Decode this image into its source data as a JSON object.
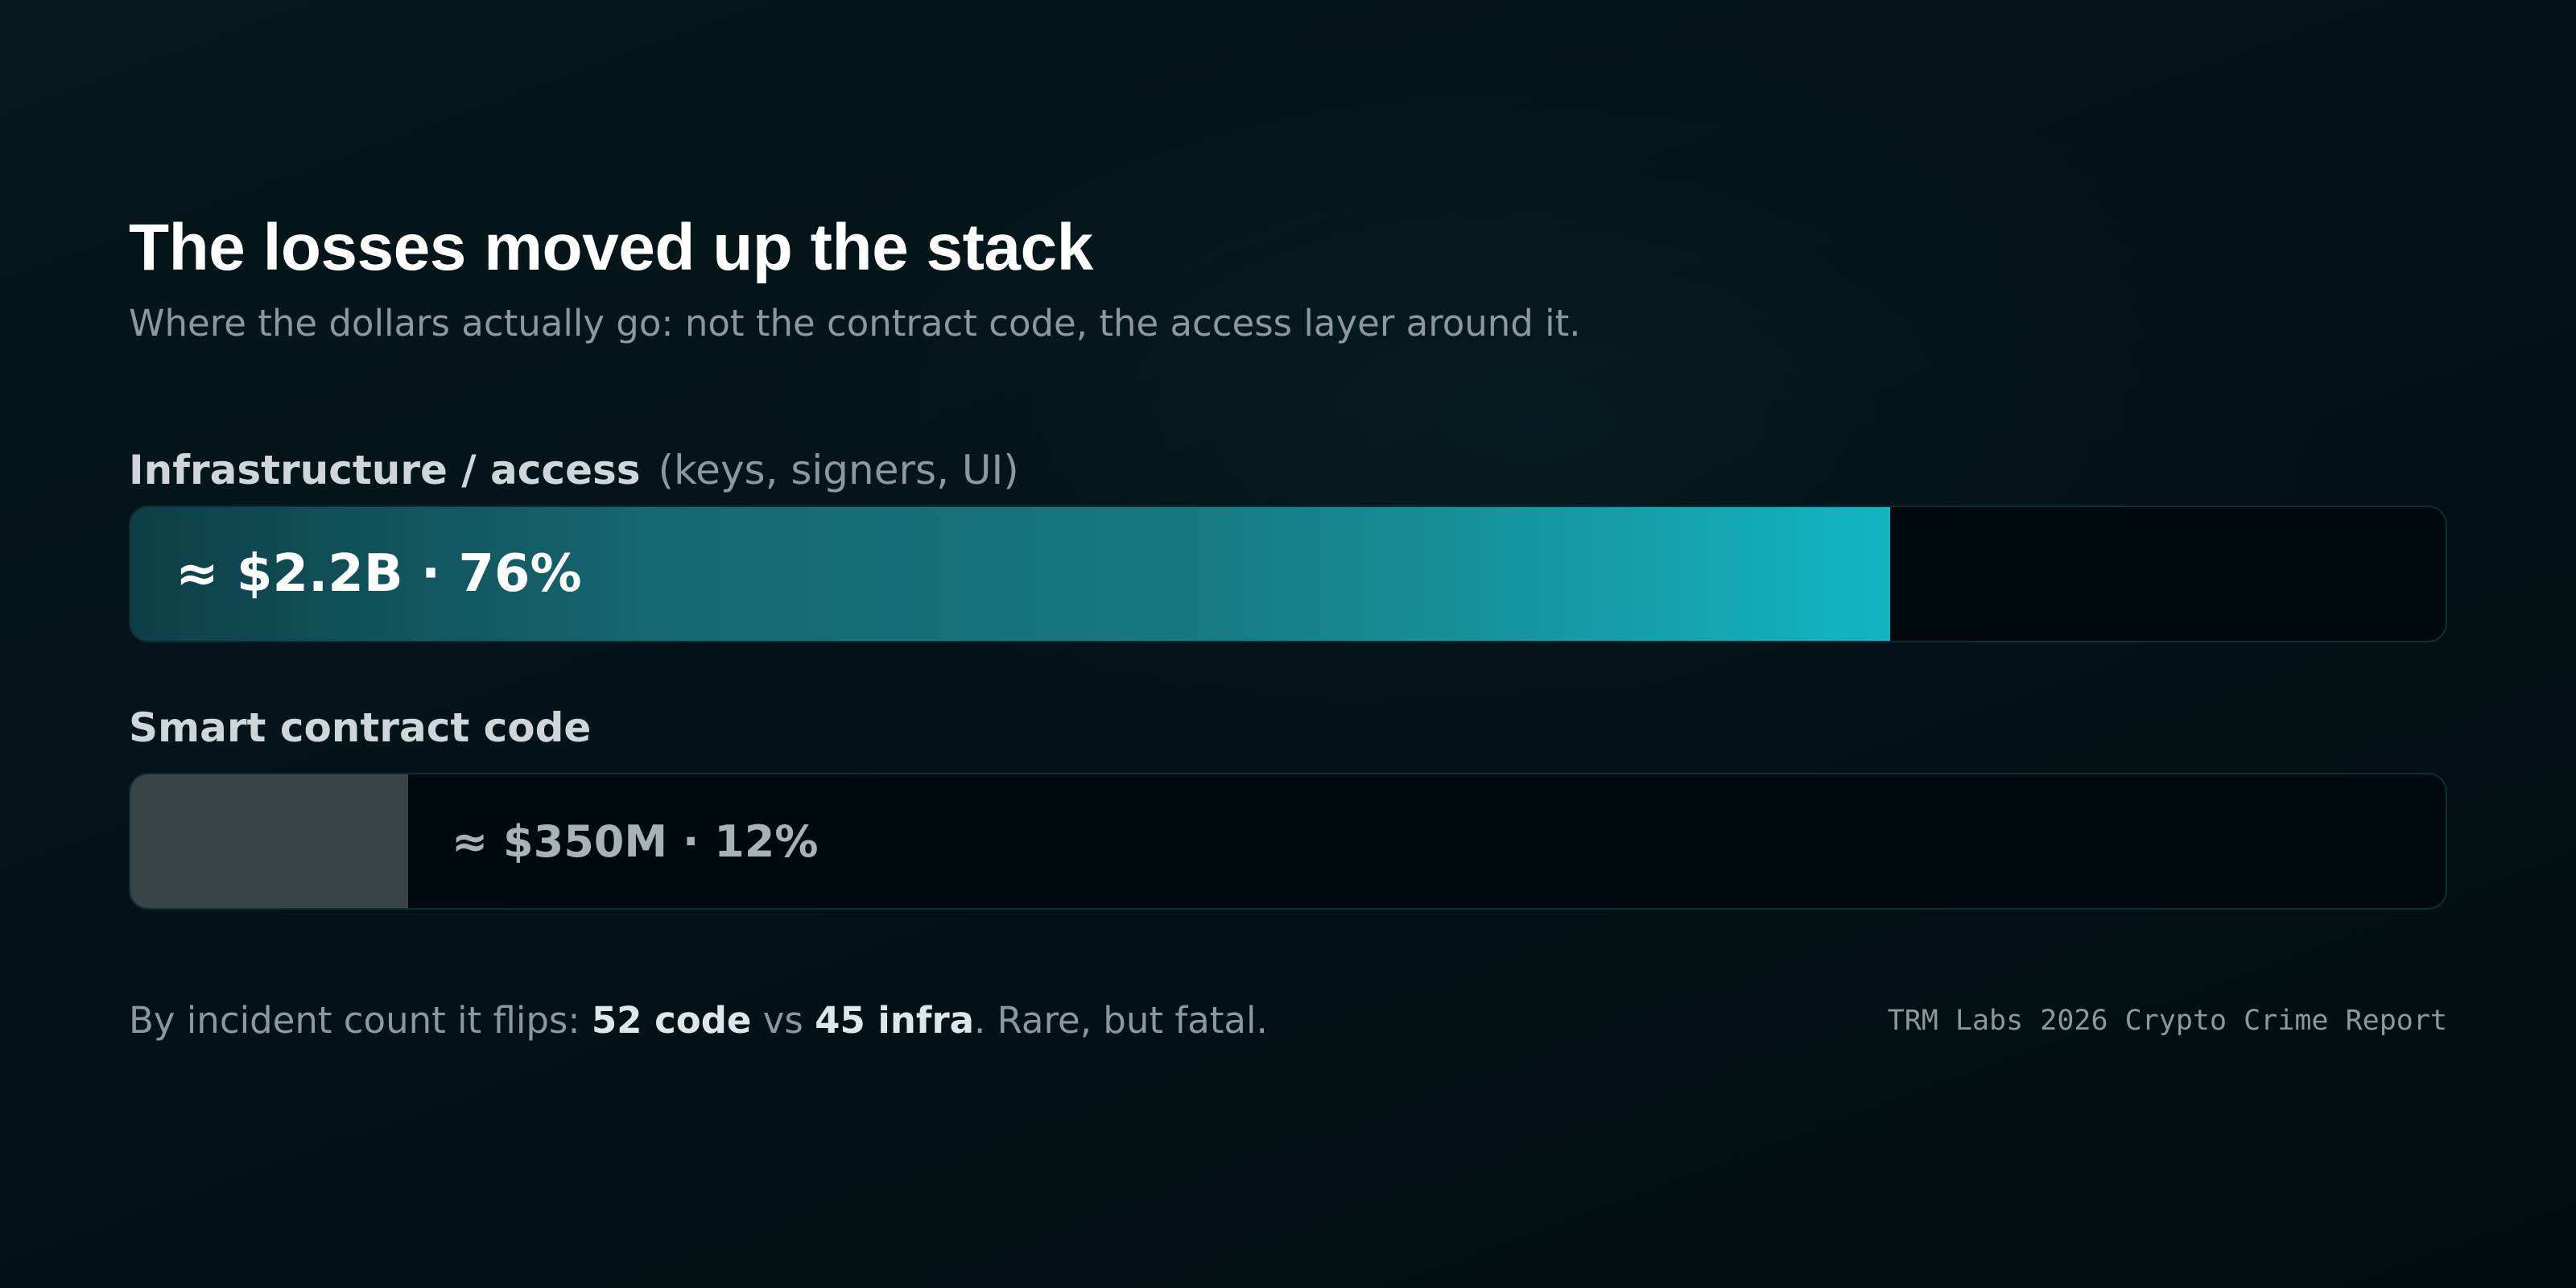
{
  "chart_data": {
    "type": "bar",
    "orientation": "horizontal",
    "title": "The losses moved up the stack",
    "subtitle": "Where the dollars actually go: not the contract code, the access layer around it.",
    "categories": [
      "Infrastructure / access",
      "Smart contract code"
    ],
    "category_details": [
      "(keys, signers, UI)",
      ""
    ],
    "values": [
      76,
      12
    ],
    "value_unit": "percent of losses",
    "data_labels": [
      "≈ $2.2B · 76%",
      "≈ $350M · 12%"
    ],
    "xlim": [
      0,
      100
    ],
    "grid": false,
    "legend": "none"
  },
  "colors": {
    "background": "#04141a",
    "infra_bar_start": "#0d3f47",
    "infra_bar_end": "#14b5c3",
    "code_bar": "#3a4447",
    "track": "#00080c",
    "muted_text": "#8b999e"
  },
  "footnote": {
    "prefix": "By incident count it flips: ",
    "code_count": "52 code",
    "middle": " vs ",
    "infra_count": "45 infra",
    "suffix": ". Rare, but fatal."
  },
  "source": "TRM Labs 2026 Crypto Crime Report"
}
